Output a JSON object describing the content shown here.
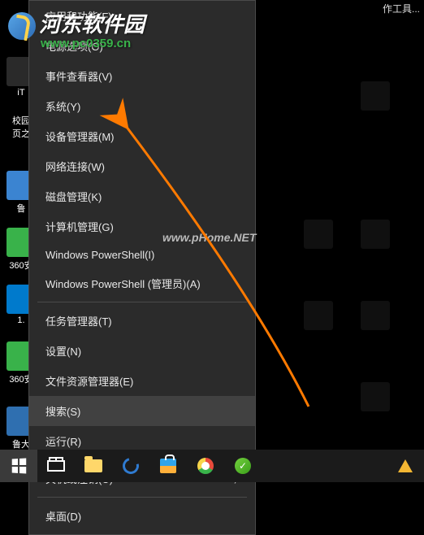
{
  "desktop": {
    "truncated_title": "作工具...",
    "icons_left": [
      "iT",
      "校园\n页之",
      " ",
      "鲁",
      "360安",
      "1.",
      " ",
      "鲁大"
    ],
    "icons_right": [
      "",
      "",
      "",
      "",
      "",
      ""
    ]
  },
  "menu": {
    "groups": [
      [
        {
          "label": "应用和功能(F)"
        },
        {
          "label": "电源选项(O)"
        },
        {
          "label": "事件查看器(V)"
        },
        {
          "label": "系统(Y)"
        },
        {
          "label": "设备管理器(M)"
        },
        {
          "label": "网络连接(W)"
        },
        {
          "label": "磁盘管理(K)"
        },
        {
          "label": "计算机管理(G)"
        },
        {
          "label": "Windows PowerShell(I)"
        },
        {
          "label": "Windows PowerShell (管理员)(A)"
        }
      ],
      [
        {
          "label": "任务管理器(T)"
        },
        {
          "label": "设置(N)"
        },
        {
          "label": "文件资源管理器(E)"
        },
        {
          "label": "搜索(S)",
          "highlight": true
        },
        {
          "label": "运行(R)"
        }
      ],
      [
        {
          "label": "关机或注销(U)",
          "submenu": true
        }
      ],
      [
        {
          "label": "桌面(D)"
        }
      ]
    ]
  },
  "watermarks": {
    "site_name": "河东软件园",
    "site_url": "www.pc0359.cn",
    "center": "www.pHome.NET"
  },
  "taskbar": {
    "items": [
      "start",
      "taskview",
      "file-explorer",
      "edge",
      "store",
      "chrome",
      "360"
    ],
    "right": [
      "matlab"
    ]
  }
}
